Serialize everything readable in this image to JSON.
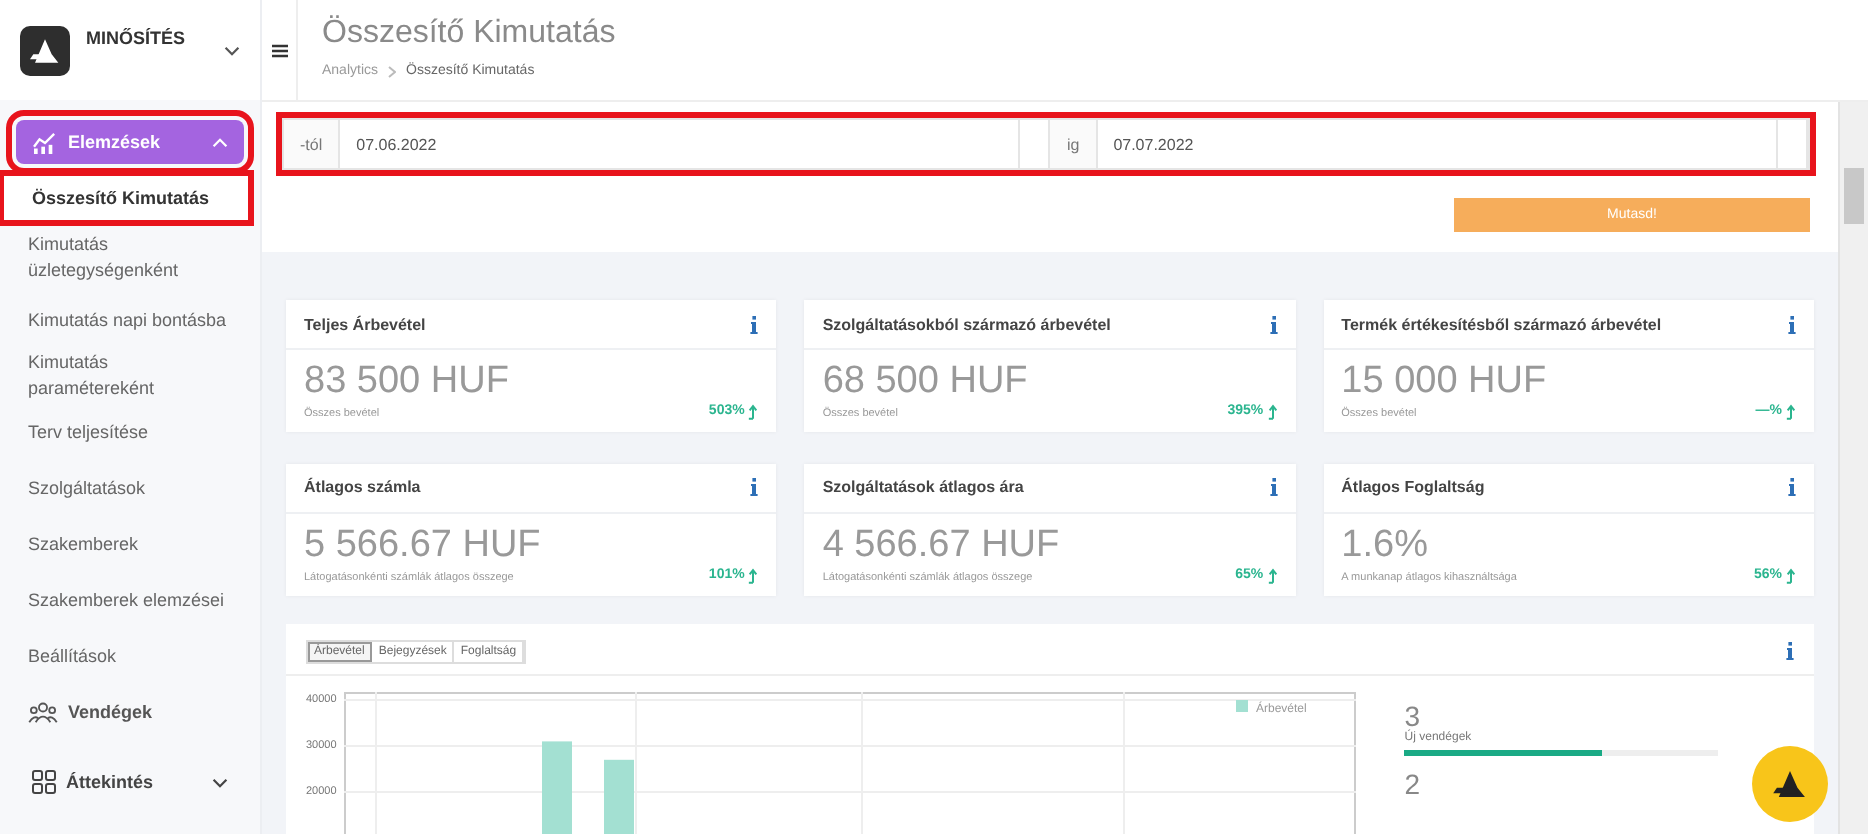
{
  "app": {
    "name": "MINŐSÍTÉS"
  },
  "header": {
    "title": "Összesítő Kimutatás",
    "breadcrumb": [
      "Analytics",
      "Összesítő Kimutatás"
    ]
  },
  "sidebar": {
    "items": [
      {
        "kind": "group",
        "label": "Elemzések",
        "selected": true,
        "expanded": true,
        "highlighted": true,
        "children": [
          {
            "label": "Összesítő Kimutatás",
            "selected": true,
            "highlighted": true
          },
          {
            "label": "Kimutatás üzletegységenként",
            "selected": false,
            "highlighted": false
          },
          {
            "label": "Kimutatás napi bontásba",
            "selected": false,
            "highlighted": false
          },
          {
            "label": "Kimutatás paramétereként",
            "selected": false,
            "highlighted": false
          },
          {
            "label": "Terv teljesítése",
            "selected": false,
            "highlighted": false
          },
          {
            "label": "Szolgáltatások",
            "selected": false,
            "highlighted": false
          },
          {
            "label": "Szakemberek",
            "selected": false,
            "highlighted": false
          },
          {
            "label": "Szakemberek elemzései",
            "selected": false,
            "highlighted": false
          },
          {
            "label": "Beállítások",
            "selected": false,
            "highlighted": false
          }
        ]
      },
      {
        "kind": "link",
        "label": "Vendégek"
      },
      {
        "kind": "group",
        "label": "Áttekintés",
        "selected": false,
        "expanded": false,
        "highlighted": false
      }
    ]
  },
  "date_filter": {
    "from_label": "-tól",
    "from_value": "07.06.2022",
    "to_label": "ig",
    "to_value": "07.07.2022",
    "highlighted": true
  },
  "submit_button": "Mutasd!",
  "cards": [
    {
      "title": "Teljes Árbevétel",
      "value": "83 500 HUF",
      "caption": "Összes bevétel",
      "change": "503%"
    },
    {
      "title": "Szolgáltatásokból származó árbevétel",
      "value": "68 500 HUF",
      "caption": "Összes bevétel",
      "change": "395%"
    },
    {
      "title": "Termék értékesítésből származó árbevétel",
      "value": "15 000 HUF",
      "caption": "Összes bevétel",
      "change": "—%"
    },
    {
      "title": "Átlagos számla",
      "value": "5 566.67 HUF",
      "caption": "Látogatásonkénti számlák átlagos összege",
      "change": "101%"
    },
    {
      "title": "Szolgáltatások átlagos ára",
      "value": "4 566.67 HUF",
      "caption": "Látogatásonkénti számlák átlagos összege",
      "change": "65%"
    },
    {
      "title": "Átlagos Foglaltság",
      "value": "1.6%",
      "caption": "A munkanap átlagos kihasználtsága",
      "change": "56%"
    }
  ],
  "chart_panel": {
    "tabs": [
      {
        "label": "Árbevétel",
        "selected": true
      },
      {
        "label": "Bejegyzések",
        "selected": false
      },
      {
        "label": "Foglaltság",
        "selected": false
      }
    ],
    "chart_data": {
      "type": "bar",
      "grid": true,
      "yticks": [
        20000,
        30000,
        40000
      ],
      "ylim": [
        0,
        40000
      ],
      "series": [
        {
          "name": "Árbevétel",
          "color": "#a3e0d2",
          "values": [
            null,
            null,
            null,
            31000,
            27000,
            null,
            null,
            null,
            null,
            null,
            null,
            null,
            null,
            null,
            null,
            null
          ]
        }
      ]
    },
    "stats": [
      {
        "value": "3",
        "label": "Új vendégek",
        "level": 0.63
      },
      {
        "value": "2"
      }
    ]
  }
}
